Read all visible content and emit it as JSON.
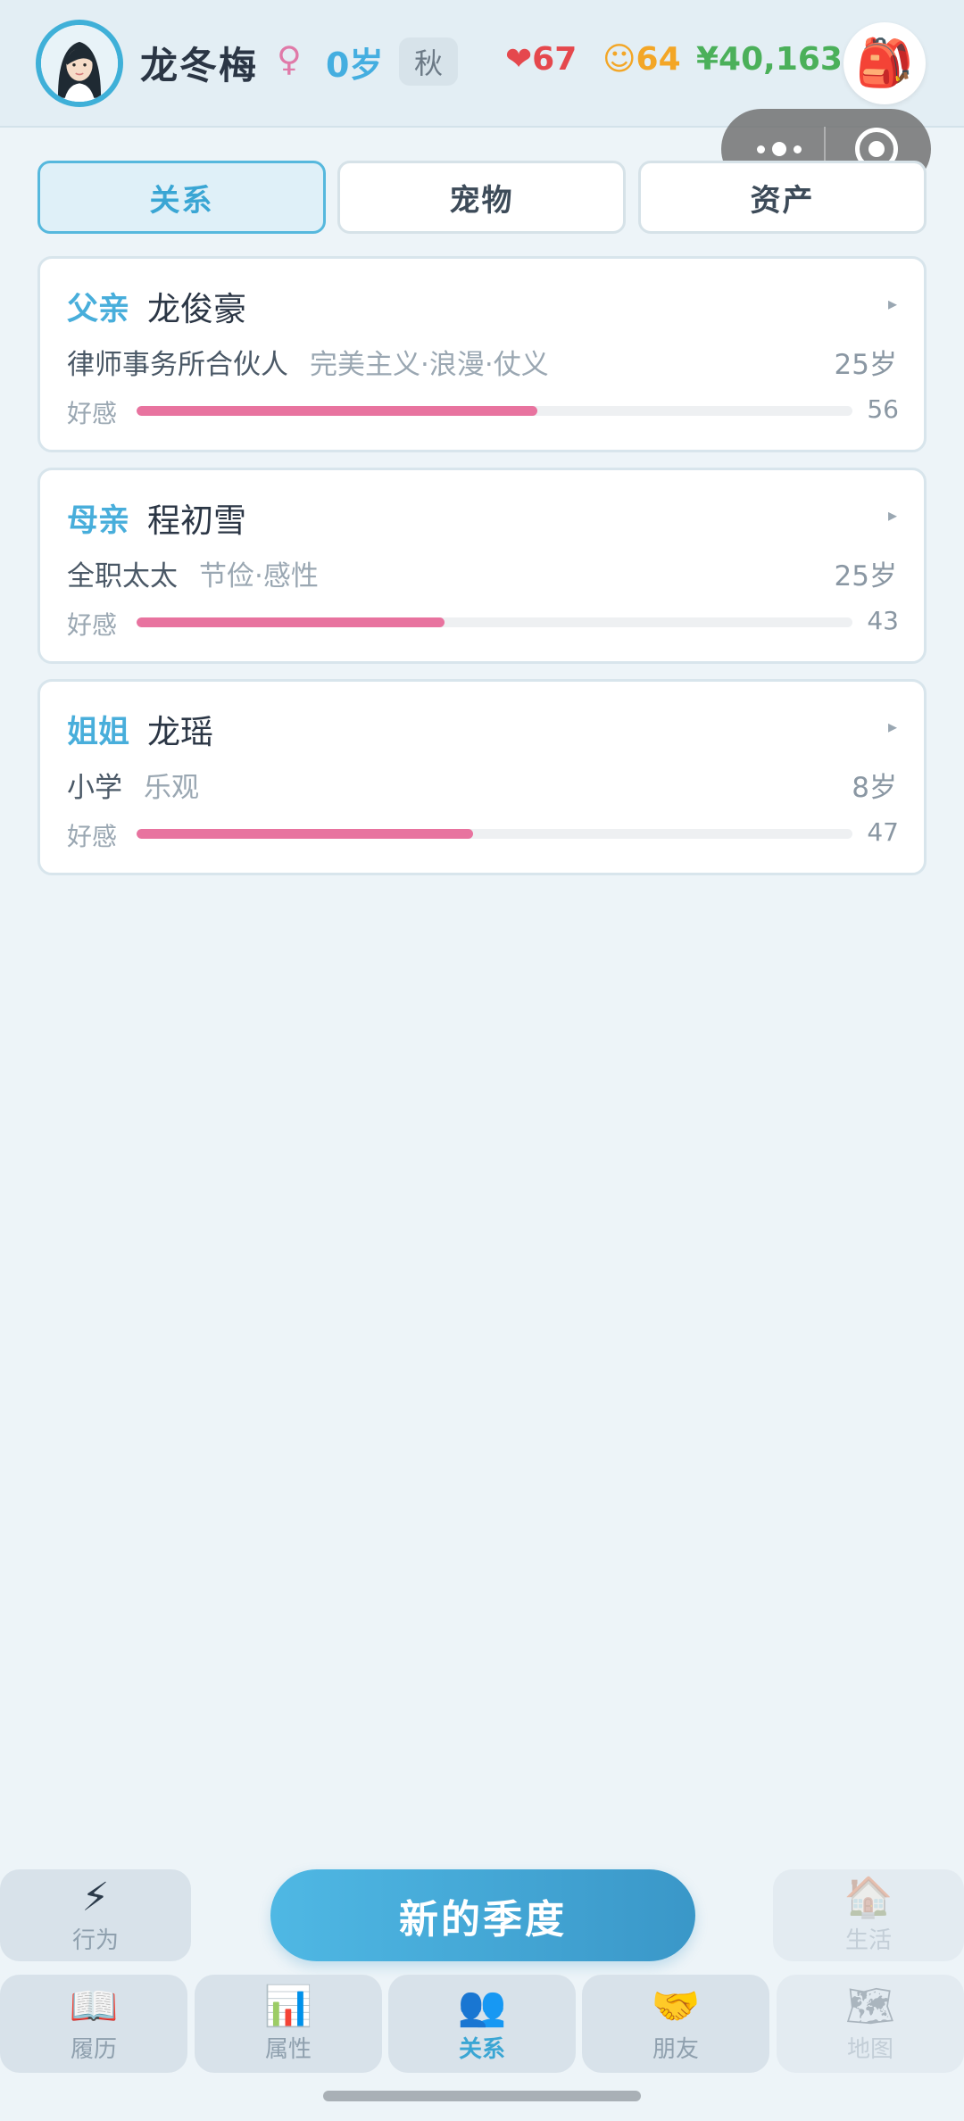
{
  "header": {
    "player_name": "龙冬梅",
    "gender_symbol": "♀",
    "age": "0岁",
    "season": "秋",
    "health": "❤67",
    "happiness": "☺64",
    "money": "¥40,163",
    "bag_icon": "🎒"
  },
  "tabs": [
    {
      "label": "关系",
      "active": true
    },
    {
      "label": "宠物",
      "active": false
    },
    {
      "label": "资产",
      "active": false
    }
  ],
  "relations": [
    {
      "role": "父亲",
      "name": "龙俊豪",
      "job": "律师事务所合伙人",
      "traits": "完美主义·浪漫·仗义",
      "age": "25岁",
      "favor_label": "好感",
      "favor": 56
    },
    {
      "role": "母亲",
      "name": "程初雪",
      "job": "全职太太",
      "traits": "节俭·感性",
      "age": "25岁",
      "favor_label": "好感",
      "favor": 43
    },
    {
      "role": "姐姐",
      "name": "龙瑶",
      "job": "小学",
      "traits": "乐观",
      "age": "8岁",
      "favor_label": "好感",
      "favor": 47
    }
  ],
  "actions": {
    "left": {
      "icon": "⚡",
      "label": "行为"
    },
    "main": "新的季度",
    "right": {
      "icon": "🏠",
      "label": "生活",
      "disabled": true
    }
  },
  "nav": [
    {
      "icon": "📖",
      "label": "履历"
    },
    {
      "icon": "📊",
      "label": "属性"
    },
    {
      "icon": "👥",
      "label": "关系",
      "active": true
    },
    {
      "icon": "🤝",
      "label": "朋友"
    },
    {
      "icon": "🗺",
      "label": "地图",
      "disabled": true
    }
  ],
  "colors": {
    "accent": "#3aa6d4",
    "favor_bar": "#e8739f",
    "health": "#e5484d",
    "happiness": "#f3a626",
    "money": "#4bb05a"
  }
}
